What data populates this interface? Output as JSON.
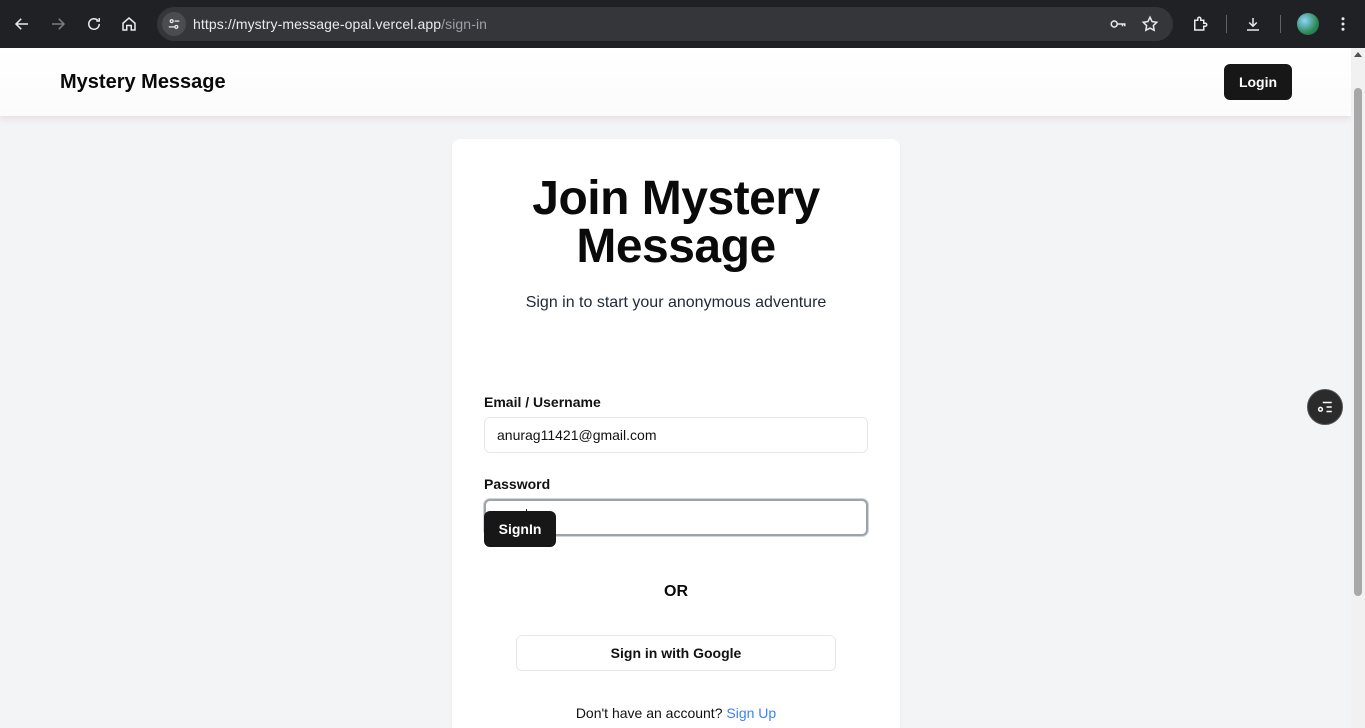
{
  "browser": {
    "url_host": "https://mystry-message-opal.vercel.app",
    "url_path": "/sign-in"
  },
  "header": {
    "brand": "Mystery Message",
    "login_label": "Login"
  },
  "card": {
    "heading_line1": "Join Mystery",
    "heading_line2": "Message",
    "subtitle": "Sign in to start your anonymous adventure",
    "email_label": "Email / Username",
    "email_value": "anurag11421@gmail.com",
    "password_label": "Password",
    "password_value": "•••••••",
    "signin_label": "SignIn",
    "or_text": "OR",
    "google_label": "Sign in with Google",
    "footer_text": "Don't have an account?",
    "signup_link": "Sign Up"
  },
  "icons": {
    "back": "arrow-left-icon",
    "forward": "arrow-right-icon",
    "reload": "reload-icon",
    "home": "home-icon",
    "site_info": "tune-icon",
    "password_key": "key-icon",
    "bookmark": "star-icon",
    "extensions": "puzzle-icon",
    "download": "download-icon",
    "menu": "more-vertical-icon",
    "floating": "list-settings-icon"
  },
  "colors": {
    "primary_button": "#171717",
    "link": "#3b82f6",
    "page_bg": "#f3f4f6",
    "chrome_bg": "#202124"
  }
}
